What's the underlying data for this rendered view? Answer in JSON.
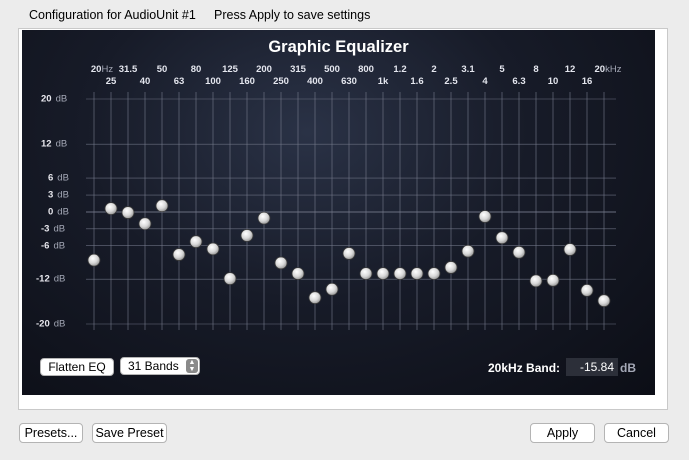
{
  "window": {
    "title": "Configuration for AudioUnit #1",
    "hint": "Press Apply to save settings"
  },
  "equalizer": {
    "title": "Graphic Equalizer",
    "db_unit": "dB",
    "freq_unit": "Hz",
    "freq_unit_khz": "kHz",
    "freq_top": [
      "20",
      "31.5",
      "50",
      "80",
      "125",
      "200",
      "315",
      "500",
      "800",
      "1.2",
      "2",
      "3.1",
      "5",
      "8",
      "12",
      "20"
    ],
    "freq_bottom": [
      "25",
      "40",
      "63",
      "100",
      "160",
      "250",
      "400",
      "630",
      "1k",
      "1.6",
      "2.5",
      "4",
      "6.3",
      "10",
      "16"
    ],
    "db_ticks": [
      "20",
      "12",
      "6",
      "3",
      "0",
      "-3",
      "-6",
      "-12",
      "-20"
    ],
    "band_gains_db": [
      -8.6,
      0.6,
      -0.1,
      -2.1,
      1.1,
      -7.6,
      -5.3,
      -6.6,
      -11.9,
      -4.2,
      -1.1,
      -9.1,
      -11.0,
      -15.3,
      -13.8,
      -7.4,
      -11.0,
      -11.0,
      -11.0,
      -11.0,
      -11.0,
      -9.9,
      -7.0,
      -0.8,
      -4.6,
      -7.2,
      -12.3,
      -12.2,
      -6.7,
      -14.0,
      -15.84
    ],
    "flatten_label": "Flatten EQ",
    "bands_select": "31 Bands",
    "selected_band_label": "20kHz Band:",
    "selected_band_value": "-15.84",
    "selected_band_unit": "dB"
  },
  "buttons": {
    "presets": "Presets...",
    "save_preset": "Save Preset",
    "apply": "Apply",
    "cancel": "Cancel"
  }
}
